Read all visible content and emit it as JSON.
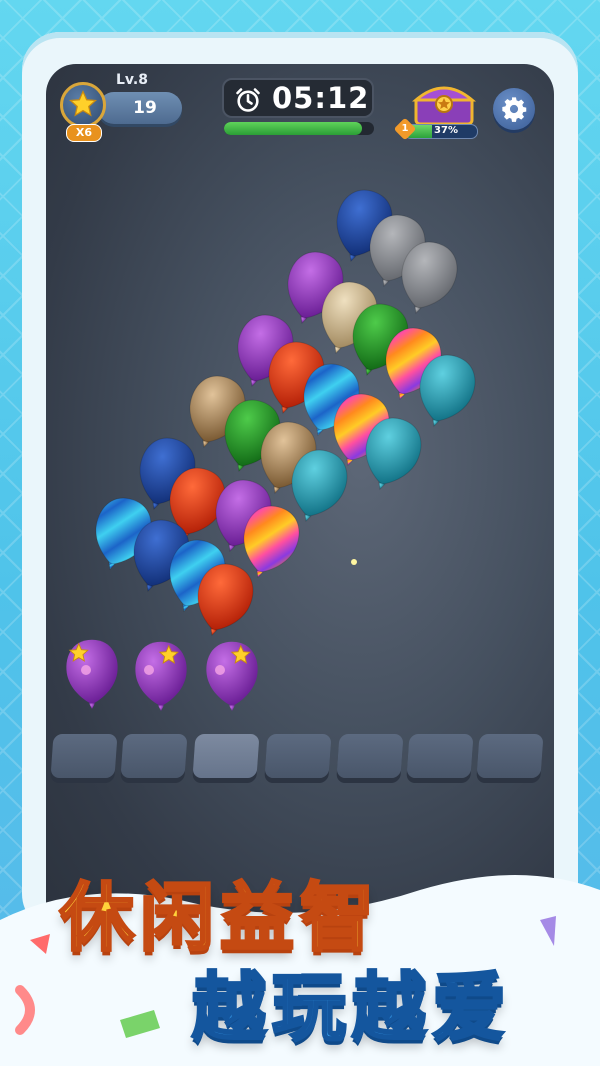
{
  "hud": {
    "level_label": "Lv.8",
    "score": "19",
    "star_multiplier": "X6",
    "timer": "05:12",
    "timer_progress": 0.92,
    "chest_level": "1",
    "chest_progress_label": "37%",
    "chest_progress": 0.37
  },
  "icons": {
    "star": "star-icon",
    "clock": "alarm-clock-icon",
    "chest": "treasure-chest-icon",
    "settings": "gear-icon"
  },
  "slots": {
    "count": 7,
    "highlighted_index": 2
  },
  "banner": {
    "line1": "休闲益智",
    "line2": "越玩越爱"
  },
  "colors": {
    "background": "#4fc3ea",
    "board": "#465160",
    "title1_fill": "#ffd23a",
    "title2_fill": "#3aa3f2"
  }
}
